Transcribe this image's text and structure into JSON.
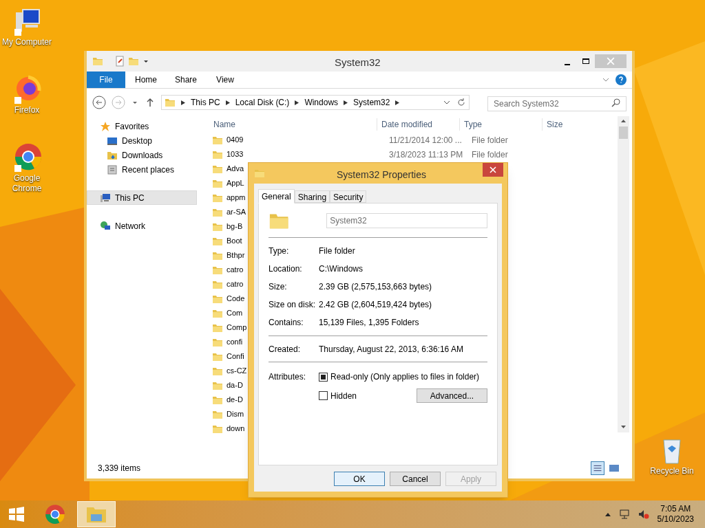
{
  "desktop_icons": [
    {
      "label": "My Computer",
      "kind": "computer"
    },
    {
      "label": "Firefox",
      "kind": "firefox"
    },
    {
      "label": "Google Chrome",
      "kind": "chrome"
    }
  ],
  "recycle_bin": {
    "label": "Recycle Bin"
  },
  "explorer": {
    "title": "System32",
    "ribbon_tabs": [
      {
        "label": "File",
        "selected": true
      },
      {
        "label": "Home",
        "selected": false
      },
      {
        "label": "Share",
        "selected": false
      },
      {
        "label": "View",
        "selected": false
      }
    ],
    "breadcrumb": [
      "This PC",
      "Local Disk (C:)",
      "Windows",
      "System32"
    ],
    "search": {
      "placeholder": "Search System32"
    },
    "columns": [
      "Name",
      "Date modified",
      "Type",
      "Size"
    ],
    "nav": [
      {
        "label": "Favorites",
        "kind": "favorites",
        "selected": false,
        "children": [
          {
            "label": "Desktop",
            "kind": "desktop",
            "selected": false
          },
          {
            "label": "Downloads",
            "kind": "downloads",
            "selected": false
          },
          {
            "label": "Recent places",
            "kind": "recent",
            "selected": false
          }
        ]
      },
      {
        "label": "This PC",
        "kind": "pc",
        "selected": true
      },
      {
        "label": "Network",
        "kind": "network",
        "selected": false
      }
    ],
    "files": [
      {
        "name": "0409",
        "date": "11/21/2014 12:00 ...",
        "type": "File folder"
      },
      {
        "name": "1033",
        "date": "3/18/2023 11:13 PM",
        "type": "File folder"
      },
      {
        "name": "Adva"
      },
      {
        "name": "AppL"
      },
      {
        "name": "appm"
      },
      {
        "name": "ar-SA"
      },
      {
        "name": "bg-B"
      },
      {
        "name": "Boot"
      },
      {
        "name": "Bthpr"
      },
      {
        "name": "catro"
      },
      {
        "name": "catro"
      },
      {
        "name": "Code"
      },
      {
        "name": "Com"
      },
      {
        "name": "Comp"
      },
      {
        "name": "confi"
      },
      {
        "name": "Confi"
      },
      {
        "name": "cs-CZ"
      },
      {
        "name": "da-D"
      },
      {
        "name": "de-D"
      },
      {
        "name": "Dism"
      },
      {
        "name": "down"
      }
    ],
    "status": "3,339 items"
  },
  "dialog": {
    "title": "System32 Properties",
    "tabs": [
      {
        "label": "General",
        "selected": true
      },
      {
        "label": "Sharing",
        "selected": false
      },
      {
        "label": "Security",
        "selected": false
      }
    ],
    "name_value": "System32",
    "fields": [
      {
        "label": "Type:",
        "value": "File folder"
      },
      {
        "label": "Location:",
        "value": "C:\\Windows"
      },
      {
        "label": "Size:",
        "value": "2.39 GB (2,575,153,663 bytes)"
      },
      {
        "label": "Size on disk:",
        "value": "2.42 GB (2,604,519,424 bytes)"
      },
      {
        "label": "Contains:",
        "value": "15,139 Files, 1,395 Folders"
      }
    ],
    "created": {
      "label": "Created:",
      "value": "Thursday, August 22, 2013, 6:36:16 AM"
    },
    "attributes_label": "Attributes:",
    "attributes": [
      {
        "label": "Read-only (Only applies to files in folder)",
        "checked": true
      },
      {
        "label": "Hidden",
        "checked": false
      }
    ],
    "advanced_button": "Advanced...",
    "buttons": [
      {
        "label": "OK",
        "default": true,
        "disabled": false
      },
      {
        "label": "Cancel",
        "default": false,
        "disabled": false
      },
      {
        "label": "Apply",
        "default": false,
        "disabled": true
      }
    ]
  },
  "taskbar": {
    "time": "7:05 AM",
    "date": "5/10/2023"
  }
}
